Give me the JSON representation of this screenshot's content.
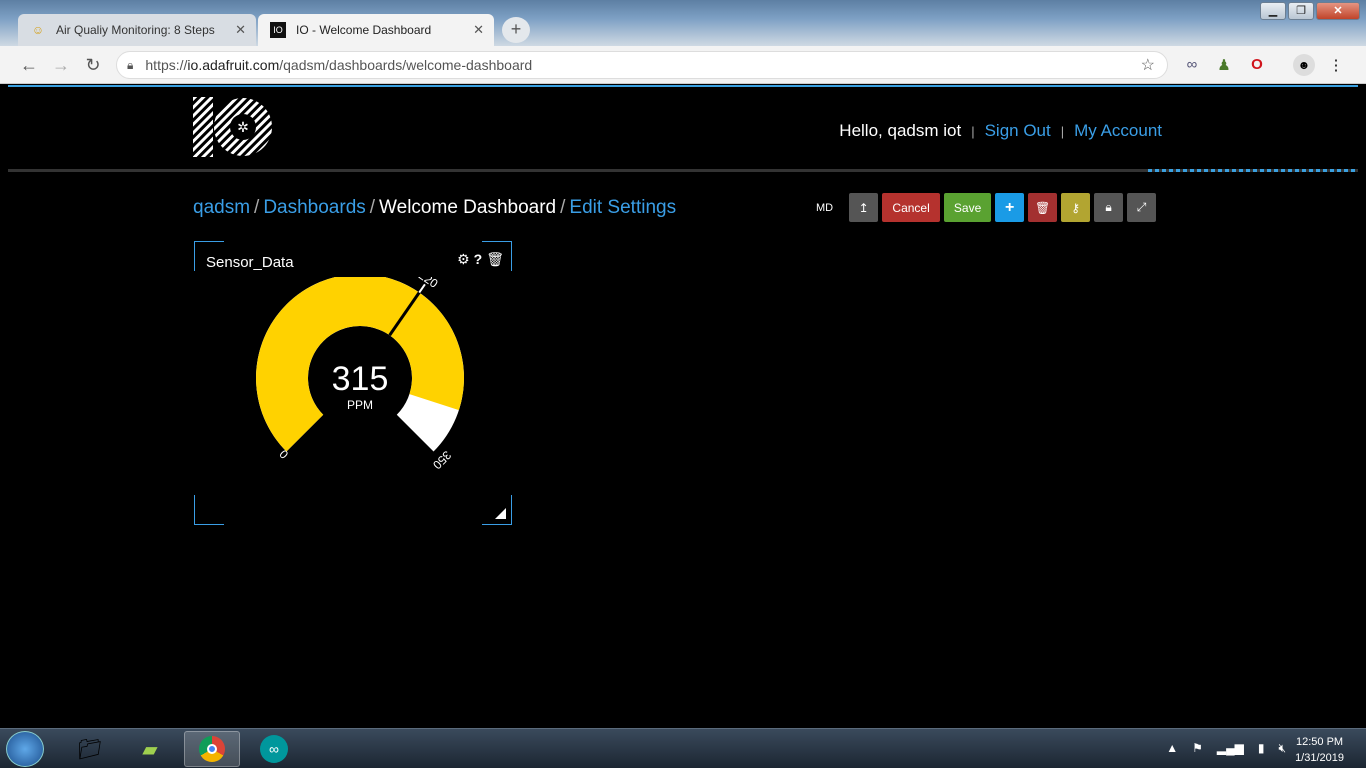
{
  "browser": {
    "tabs": [
      {
        "label": "Air Qualiy Monitoring: 8 Steps",
        "icon": "instructables-icon"
      },
      {
        "label": "IO - Welcome Dashboard",
        "icon": "io-icon"
      }
    ],
    "url_prefix": "https://",
    "url_host": "io.adafruit.com",
    "url_path": "/qadsm/dashboards/welcome-dashboard"
  },
  "header": {
    "greeting": "Hello, qadsm iot",
    "sep": "|",
    "sign_out": "Sign Out",
    "my_account": "My Account"
  },
  "breadcrumb": {
    "user": "qadsm",
    "dashboards": "Dashboards",
    "current": "Welcome Dashboard",
    "edit": "Edit Settings",
    "sep": "/"
  },
  "actions": {
    "md": "MD",
    "cancel": "Cancel",
    "save": "Save"
  },
  "widget": {
    "title": "Sensor_Data",
    "value": "315",
    "unit": "PPM",
    "min_label": "0",
    "mid_label": "220",
    "max_label": "350",
    "min": 0,
    "max": 350,
    "current": 315,
    "threshold": 220,
    "fill_color": "#ffd200",
    "empty_color": "#ffffff"
  },
  "taskbar": {
    "time": "12:50 PM",
    "date": "1/31/2019"
  }
}
